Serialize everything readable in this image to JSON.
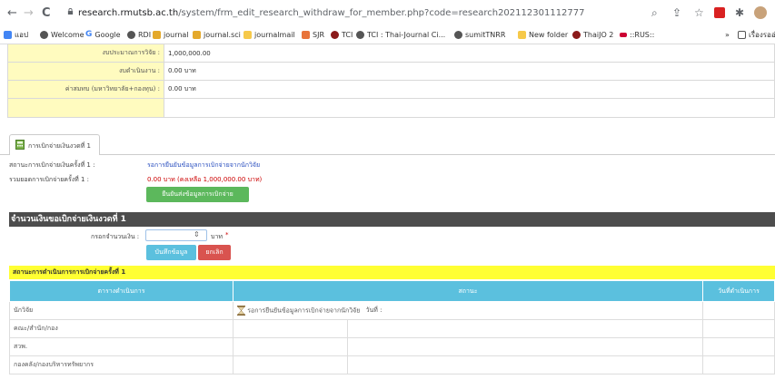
{
  "browser": {
    "back": "←",
    "forward": "→",
    "reload": "C",
    "url_host": "research.rmutsb.ac.th",
    "url_path": "/system/frm_edit_research_withdraw_for_member.php?code=research202112301112777",
    "bookmarks": [
      "แอป",
      "Welcome",
      "Google",
      "RDI",
      "journal",
      "journal.sci",
      "journalmail",
      "SJR",
      "TCI",
      "TCI : Thai-Journal Ci...",
      "sumitTNRR",
      "New folder",
      "ThaiJO 2",
      "::RUS::",
      "»",
      "เรื่องรออ่าน"
    ]
  },
  "budget": {
    "rows": [
      {
        "label": "งบประมาณการวิจัย :",
        "value": "1,000,000.00"
      },
      {
        "label": "งบดำเนินงาน :",
        "value": "0.00 บาท"
      },
      {
        "label": "ค่าสมทบ (มหาวิทยาลัย+กองทุน) :",
        "value": "0.00 บาท"
      },
      {
        "label": "",
        "value": ""
      }
    ]
  },
  "tab": {
    "label": "การเบิกจ่ายเงินงวดที่ 1"
  },
  "withdraw": {
    "status_label": "สถานะการเบิกจ่ายเงินครั้งที่ 1 :",
    "status_value": "รอการยืนยันข้อมูลการเบิกจ่ายจากนักวิจัย",
    "total_label": "รวมยอดการเบิกจ่ายครั้งที่ 1 :",
    "total_value": "0.00 บาท (คงเหลือ 1,000,000.00 บาท)",
    "confirm_button": "ยืนยันส่งข้อมูลการเบิกจ่าย"
  },
  "amount_section": {
    "title": "จำนวนเงินขอเบิกจ่ายเงินงวดที่ 1",
    "input_label": "กรอกจำนวนเงิน :",
    "input_value": "",
    "unit": "บาท",
    "required_mark": "*",
    "save_button": "บันทึกข้อมูล",
    "cancel_button": "ยกเลิก"
  },
  "process": {
    "title": "สถานะการดำเนินการการเบิกจ่ายครั้งที่ 1",
    "headers": [
      "ตารางดำเนินการ",
      "สถานะ",
      "วันที่ดำเนินการ"
    ],
    "rows": [
      {
        "step": "นักวิจัย",
        "status": "รอการยืนยันข้อมูลการเบิกจ่ายจากนักวิจัย",
        "date_label": "วันที่ :"
      },
      {
        "step": "คณะ/สำนัก/กอง",
        "status": "",
        "date_label": ""
      },
      {
        "step": "สวพ.",
        "status": "",
        "date_label": ""
      },
      {
        "step": "กองคลัง/กองบริหารทรัพยากร",
        "status": "",
        "date_label": ""
      }
    ]
  },
  "colors": {
    "accent_blue": "#5bc0de",
    "green": "#5cb85c",
    "red": "#d9534f",
    "yellow": "#ffff33"
  }
}
